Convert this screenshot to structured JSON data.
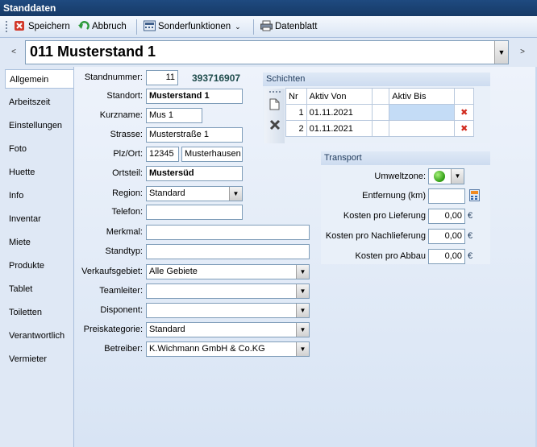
{
  "window": {
    "title": "Standdaten"
  },
  "toolbar": {
    "save": "Speichern",
    "cancel": "Abbruch",
    "special": "Sonderfunktionen",
    "datasheet": "Datenblatt"
  },
  "nav": {
    "prev": "<",
    "next": ">",
    "record": "011 Musterstand 1"
  },
  "tabs": [
    "Allgemein",
    "Arbeitszeit",
    "Einstellungen",
    "Foto",
    "Huette",
    "Info",
    "Inventar",
    "Miete",
    "Produkte",
    "Tablet",
    "Toiletten",
    "Verantwortlich",
    "Vermieter"
  ],
  "form": {
    "standnummer_label": "Standnummer:",
    "standnummer": "11",
    "code": "393716907",
    "standort_label": "Standort:",
    "standort": "Musterstand 1",
    "kurzname_label": "Kurzname:",
    "kurzname": "Mus 1",
    "strasse_label": "Strasse:",
    "strasse": "Musterstraße 1",
    "plz_label": "Plz/Ort:",
    "plz": "12345",
    "ort": "Musterhausen",
    "ortsteil_label": "Ortsteil:",
    "ortsteil": "Mustersüd",
    "region_label": "Region:",
    "region": "Standard",
    "telefon_label": "Telefon:",
    "telefon": "",
    "merkmal_label": "Merkmal:",
    "merkmal": "",
    "standtyp_label": "Standtyp:",
    "standtyp": "",
    "verkaufsgebiet_label": "Verkaufsgebiet:",
    "verkaufsgebiet": "Alle Gebiete",
    "teamleiter_label": "Teamleiter:",
    "teamleiter": "",
    "disponent_label": "Disponent:",
    "disponent": "",
    "preiskategorie_label": "Preiskategorie:",
    "preiskategorie": "Standard",
    "betreiber_label": "Betreiber:",
    "betreiber": "K.Wichmann GmbH & Co.KG"
  },
  "schichten": {
    "title": "Schichten",
    "columns": [
      "Nr",
      "Aktiv Von",
      "",
      "Aktiv Bis",
      ""
    ],
    "rows": [
      {
        "nr": "1",
        "von": "01.11.2021",
        "bis": ""
      },
      {
        "nr": "2",
        "von": "01.11.2021",
        "bis": ""
      }
    ]
  },
  "transport": {
    "title": "Transport",
    "umweltzone_label": "Umweltzone:",
    "entfernung_label": "Entfernung (km)",
    "entfernung": "",
    "lieferung_label": "Kosten pro Lieferung",
    "lieferung": "0,00",
    "nachlieferung_label": "Kosten pro Nachlieferung",
    "nachlieferung": "0,00",
    "abbau_label": "Kosten pro Abbau",
    "abbau": "0,00",
    "currency": "€"
  }
}
